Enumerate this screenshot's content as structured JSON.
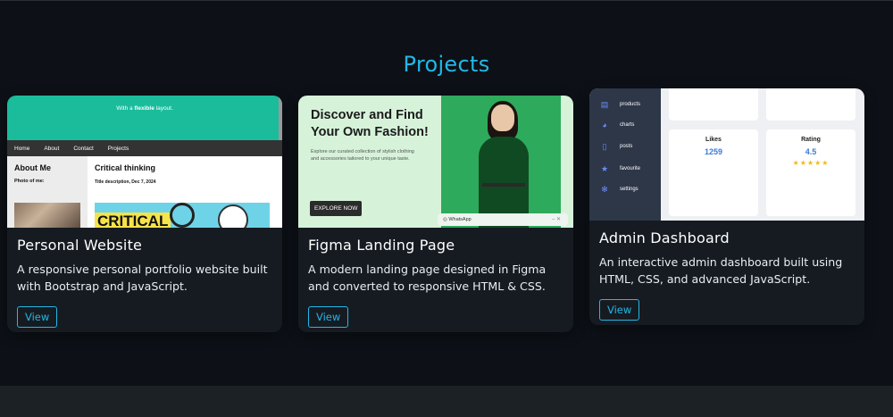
{
  "section": {
    "title": "Projects"
  },
  "projects": [
    {
      "title": "Personal Website",
      "description": "A responsive personal portfolio website built with Bootstrap and JavaScript.",
      "button": "View",
      "preview": {
        "tagline_prefix": "With a ",
        "tagline_bold": "flexible",
        "tagline_suffix": " layout.",
        "nav": [
          "Home",
          "About",
          "Contact",
          "Projects"
        ],
        "sidebar_heading": "About Me",
        "sidebar_sub": "Photo of me:",
        "main_heading": "Critical thinking",
        "main_sub": "Title description, Dec 7, 2024",
        "image_text": "CRITICAL"
      }
    },
    {
      "title": "Figma Landing Page",
      "description": "A modern landing page designed in Figma and converted to responsive HTML & CSS.",
      "button": "View",
      "preview": {
        "headline": "Discover and Find Your Own Fashion!",
        "subtext": "Explore our curated collection of stylish clothing and accessories tailored to your unique taste.",
        "cta": "EXPLORE NOW",
        "chat_label": "WhatsApp"
      }
    },
    {
      "title": "Admin Dashboard",
      "description": "An interactive admin dashboard built using HTML, CSS, and advanced JavaScript.",
      "button": "View",
      "preview": {
        "menu": [
          "products",
          "charts",
          "posts",
          "favourite",
          "settings"
        ],
        "likes_label": "Likes",
        "likes_value": "1259",
        "rating_label": "Rating",
        "rating_value": "4.5",
        "rating_stars": "★★★★★"
      }
    }
  ],
  "colors": {
    "accent": "#22b8e6",
    "page_bg": "#0d1117",
    "card_bg": "#161b22"
  }
}
